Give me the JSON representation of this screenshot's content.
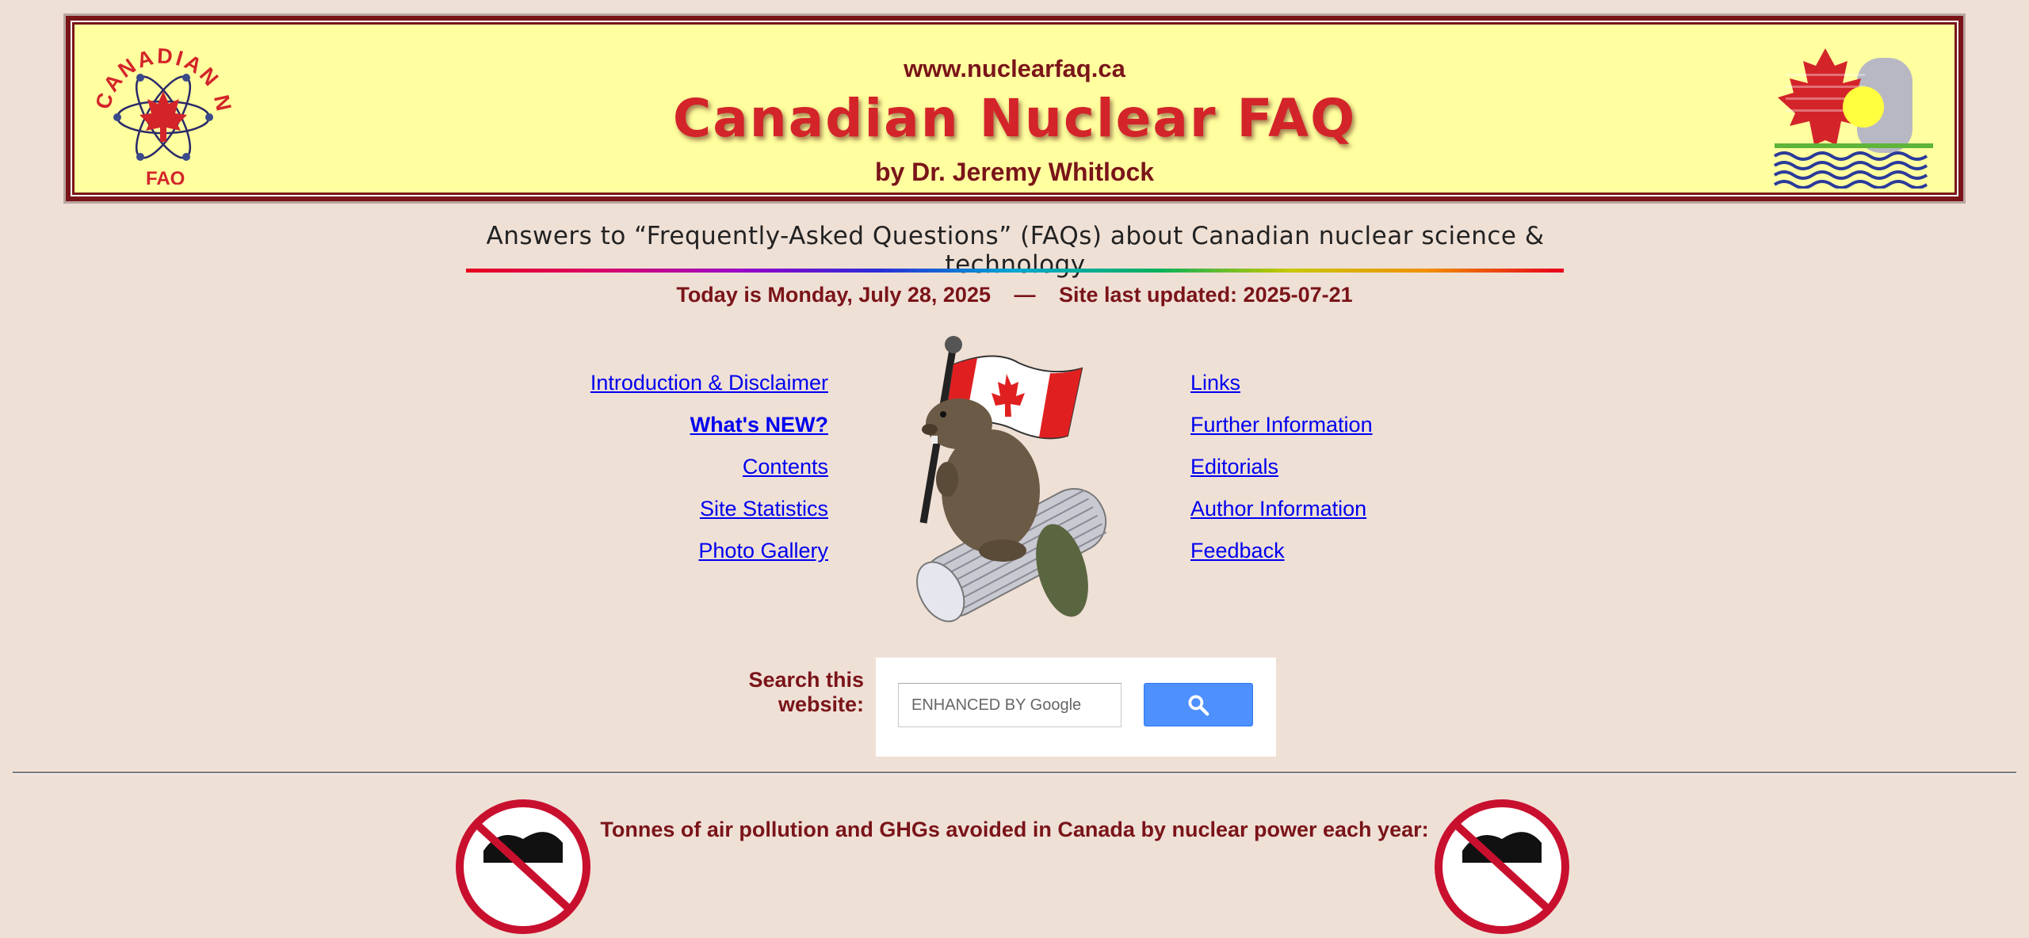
{
  "banner": {
    "url": "www.nuclearfaq.ca",
    "title": "Canadian Nuclear FAQ",
    "author": "by Dr. Jeremy Whitlock",
    "logo_left_text": "CANADIAN NUCLEAR FAQ"
  },
  "tagline": "Answers to “Frequently-Asked Questions” (FAQs) about Canadian nuclear science & technology",
  "date_line": {
    "today": "Today is Monday, July 28, 2025",
    "separator": "—",
    "updated": "Site last updated: 2025-07-21"
  },
  "nav_left": [
    "Introduction & Disclaimer",
    "What's NEW?",
    "Contents",
    "Site Statistics",
    "Photo Gallery"
  ],
  "nav_right": [
    "Links",
    "Further Information",
    "Editorials",
    "Author Information",
    "Feedback"
  ],
  "search": {
    "label_line1": "Search this",
    "label_line2": "website:",
    "placeholder": "ENHANCED BY Google"
  },
  "pollution_text": "Tonnes of air pollution and GHGs avoided in Canada by nuclear power each year:",
  "colors": {
    "background": "#efe0d6",
    "banner_fill": "#ffff9f",
    "maroon": "#7a1419",
    "title_red": "#d3242a",
    "link": "#0000ee",
    "search_button": "#4d90fe"
  }
}
